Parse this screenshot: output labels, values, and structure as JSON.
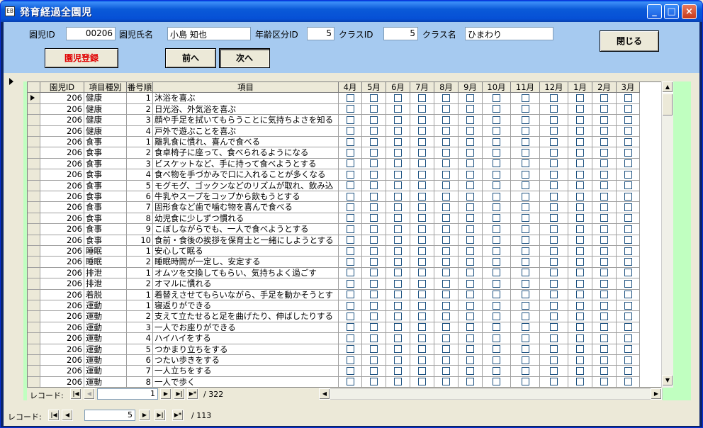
{
  "window": {
    "title": "発育経過全園児",
    "icon_text": "EB",
    "minimize": "_",
    "maximize": "□",
    "close": "×"
  },
  "header": {
    "child_id_label": "園児ID",
    "child_id_value": "00206",
    "child_name_label": "園児氏名",
    "child_name_value": "小島 知也",
    "age_group_label": "年齢区分ID",
    "age_group_value": "5",
    "class_id_label": "クラスID",
    "class_id_value": "5",
    "class_name_label": "クラス名",
    "class_name_value": "ひまわり",
    "register_button": "園児登録",
    "prev_button": "前へ",
    "next_button": "次へ",
    "close_button": "閉じる"
  },
  "table": {
    "columns": [
      "園児ID",
      "項目種別",
      "番号順",
      "項目",
      "4月",
      "5月",
      "6月",
      "7月",
      "8月",
      "9月",
      "10月",
      "11月",
      "12月",
      "1月",
      "2月",
      "3月"
    ],
    "rows": [
      [
        "206",
        "健康",
        "1",
        "沐浴を喜ぶ"
      ],
      [
        "206",
        "健康",
        "2",
        "日光浴、外気浴を喜ぶ"
      ],
      [
        "206",
        "健康",
        "3",
        "顔や手足を拭いてもらうことに気持ちよさを知る"
      ],
      [
        "206",
        "健康",
        "4",
        "戸外で遊ぶことを喜ぶ"
      ],
      [
        "206",
        "食事",
        "1",
        "離乳食に慣れ、喜んで食べる"
      ],
      [
        "206",
        "食事",
        "2",
        "食卓椅子に座って、食べられるようになる"
      ],
      [
        "206",
        "食事",
        "3",
        "ビスケットなど、手に持って食べようとする"
      ],
      [
        "206",
        "食事",
        "4",
        "食べ物を手づかみで口に入れることが多くなる"
      ],
      [
        "206",
        "食事",
        "5",
        "モグモグ、ゴックンなどのリズムが取れ、飲み込"
      ],
      [
        "206",
        "食事",
        "6",
        "牛乳やスープをコップから飲もうとする"
      ],
      [
        "206",
        "食事",
        "7",
        "固形食など歯で噛む物を喜んで食べる"
      ],
      [
        "206",
        "食事",
        "8",
        "幼児食に少しずつ慣れる"
      ],
      [
        "206",
        "食事",
        "9",
        "こぼしながらでも、一人で食べようとする"
      ],
      [
        "206",
        "食事",
        "10",
        "食前・食後の挨拶を保育士と一緒にしようとする"
      ],
      [
        "206",
        "睡眠",
        "1",
        "安心して眠る"
      ],
      [
        "206",
        "睡眠",
        "2",
        "睡眠時間が一定し、安定する"
      ],
      [
        "206",
        "排泄",
        "1",
        "オムツを交換してもらい、気持ちよく過ごす"
      ],
      [
        "206",
        "排泄",
        "2",
        "オマルに慣れる"
      ],
      [
        "206",
        "着脱",
        "1",
        "着替えさせてもらいながら、手足を動かそうとす"
      ],
      [
        "206",
        "運動",
        "1",
        "寝返りができる"
      ],
      [
        "206",
        "運動",
        "2",
        "支えて立たせると足を曲げたり、伸ばしたりする"
      ],
      [
        "206",
        "運動",
        "3",
        "一人でお座りができる"
      ],
      [
        "206",
        "運動",
        "4",
        "ハイハイをする"
      ],
      [
        "206",
        "運動",
        "5",
        "つかまり立ちをする"
      ],
      [
        "206",
        "運動",
        "6",
        "つたい歩きをする"
      ],
      [
        "206",
        "運動",
        "7",
        "一人立ちをする"
      ],
      [
        "206",
        "運動",
        "8",
        "一人で歩く"
      ]
    ]
  },
  "subform_nav": {
    "label": "レコード:",
    "current": "1",
    "total": "/ 322"
  },
  "main_nav": {
    "label": "レコード:",
    "current": "5",
    "total": "/ 113"
  },
  "icons": {
    "first": "|◀",
    "prev": "◀",
    "next": "▶",
    "last": "▶|",
    "new": "▶*",
    "up": "▲",
    "down": "▼",
    "left": "◀",
    "right": "▶"
  }
}
